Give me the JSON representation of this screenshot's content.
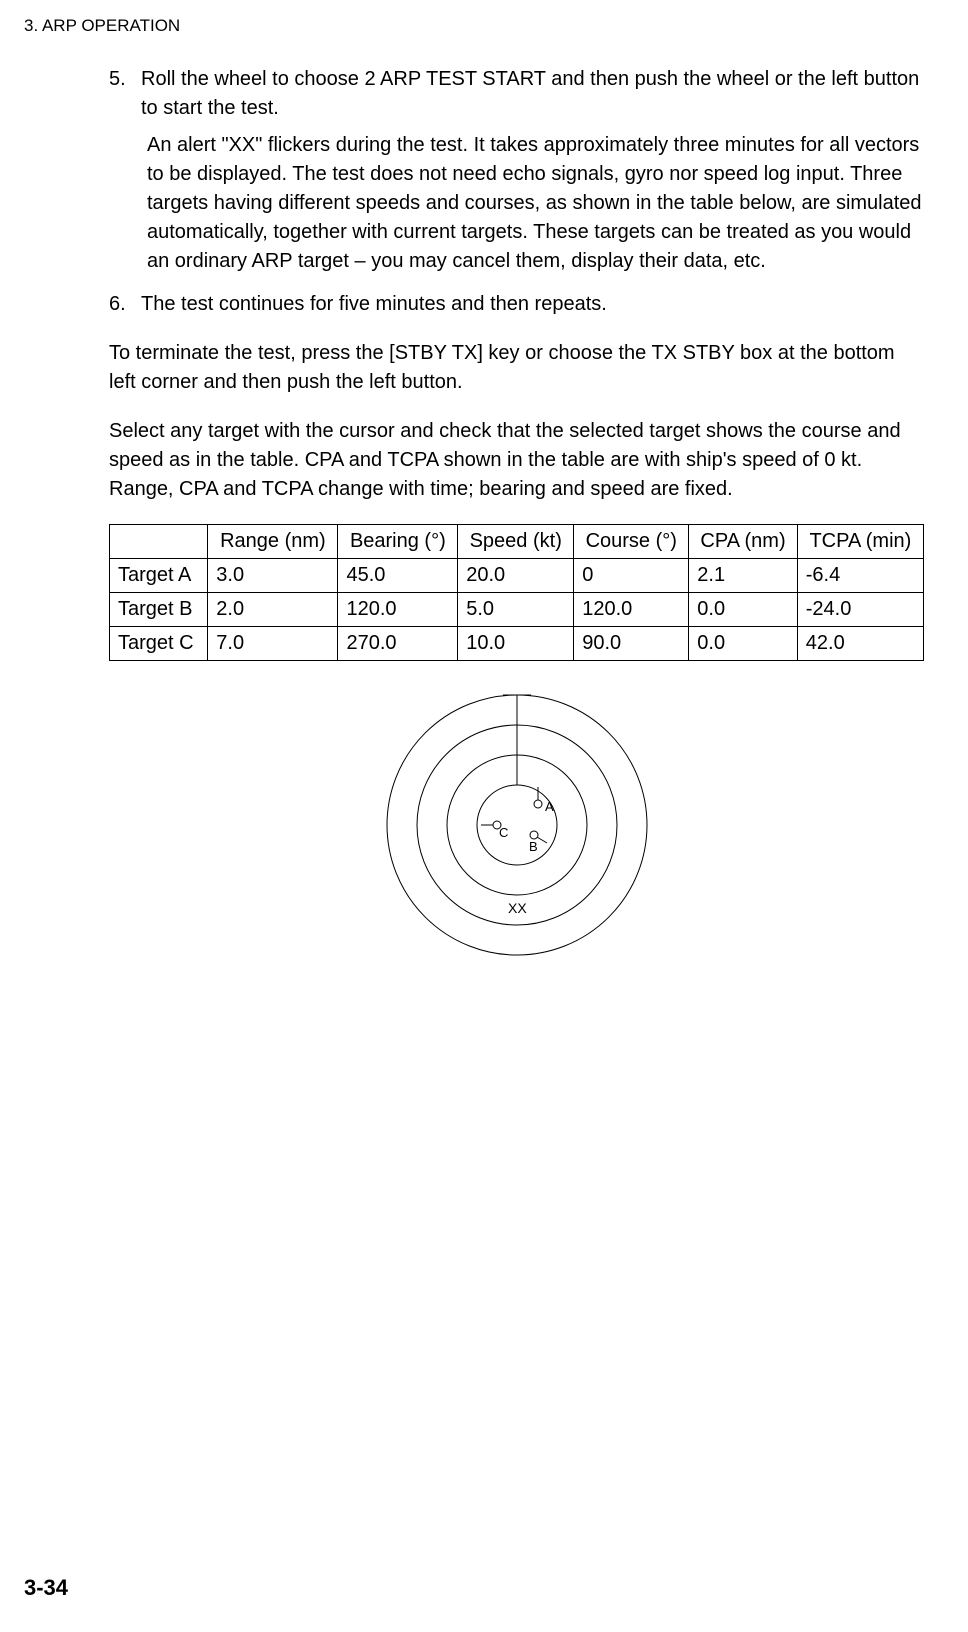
{
  "header": "3. ARP OPERATION",
  "item5": {
    "num": "5.",
    "text": "Roll the wheel to choose 2 ARP TEST START and then push the wheel or the left button to start the test.",
    "sub": "An alert \"XX\" flickers during the test. It takes approximately three minutes for all vectors to be displayed. The test does not need echo signals, gyro nor speed log input. Three targets having different speeds and courses, as shown in the table below, are simulated automatically, together with current targets. These targets can be treated as you would an ordinary ARP target – you may cancel them, display their data, etc."
  },
  "item6": {
    "num": "6.",
    "text": "The test continues for five minutes and then repeats."
  },
  "para1": "To terminate the test, press the [STBY TX] key or choose the TX STBY box at the bottom left corner and then push the left button.",
  "para2": "Select any target with the cursor and check that the selected target shows the course and speed as in the table. CPA and TCPA shown in the table are with ship's speed of 0 kt. Range, CPA and TCPA change with time; bearing and speed are fixed.",
  "table": {
    "headers": [
      "",
      "Range (nm)",
      "Bearing (°)",
      "Speed (kt)",
      "Course (°)",
      "CPA (nm)",
      "TCPA (min)"
    ],
    "rows": [
      [
        "Target A",
        "3.0",
        "45.0",
        "20.0",
        "0",
        "2.1",
        "-6.4"
      ],
      [
        "Target B",
        "2.0",
        "120.0",
        "5.0",
        "120.0",
        "0.0",
        "-24.0"
      ],
      [
        "Target C",
        "7.0",
        "270.0",
        "10.0",
        "90.0",
        "0.0",
        "42.0"
      ]
    ]
  },
  "diagram": {
    "A": "A",
    "B": "B",
    "C": "C",
    "XX": "XX"
  },
  "pageNum": "3-34"
}
